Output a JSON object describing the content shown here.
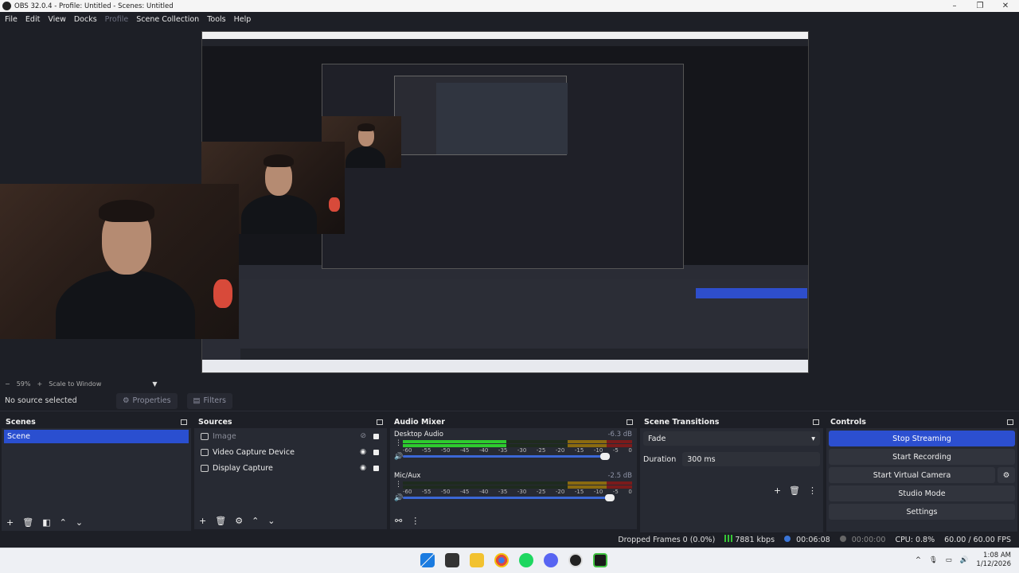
{
  "window": {
    "title": "OBS 32.0.4 - Profile: Untitled - Scenes: Untitled",
    "controls": [
      "–",
      "❐",
      "✕"
    ]
  },
  "menu": [
    {
      "label": "File",
      "enabled": true
    },
    {
      "label": "Edit",
      "enabled": true
    },
    {
      "label": "View",
      "enabled": true
    },
    {
      "label": "Docks",
      "enabled": true
    },
    {
      "label": "Profile",
      "enabled": false
    },
    {
      "label": "Scene Collection",
      "enabled": true
    },
    {
      "label": "Tools",
      "enabled": true
    },
    {
      "label": "Help",
      "enabled": true
    }
  ],
  "zoom": {
    "minus": "−",
    "value": "59%",
    "plus": "+",
    "mode": "Scale to Window",
    "arrow": "▼"
  },
  "source_bar": {
    "status": "No source selected",
    "properties": "Properties",
    "filters": "Filters"
  },
  "scenes": {
    "title": "Scenes",
    "items": [
      "Scene"
    ]
  },
  "sources": {
    "title": "Sources",
    "items": [
      {
        "label": "Image",
        "visible": false
      },
      {
        "label": "Video Capture Device",
        "visible": true
      },
      {
        "label": "Display Capture",
        "visible": true
      }
    ]
  },
  "audio_mixer": {
    "title": "Audio Mixer",
    "ticks": [
      "-60",
      "-55",
      "-50",
      "-45",
      "-40",
      "-35",
      "-30",
      "-25",
      "-20",
      "-15",
      "-10",
      "-5",
      "0"
    ],
    "channels": [
      {
        "name": "Desktop Audio",
        "db": "-6.3 dB",
        "level": 0.45
      },
      {
        "name": "Mic/Aux",
        "db": "-2.5 dB",
        "level": 0.0
      }
    ]
  },
  "transitions": {
    "title": "Scene Transitions",
    "selected": "Fade",
    "duration_label": "Duration",
    "duration_value": "300 ms"
  },
  "controls": {
    "title": "Controls",
    "stop_streaming": "Stop Streaming",
    "start_recording": "Start Recording",
    "start_virtual_camera": "Start Virtual Camera",
    "studio_mode": "Studio Mode",
    "settings": "Settings"
  },
  "status": {
    "dropped_frames": "Dropped Frames 0 (0.0%)",
    "bitrate": "7881 kbps",
    "stream_time": "00:06:08",
    "record_time": "00:00:00",
    "cpu": "CPU: 0.8%",
    "fps": "60.00 / 60.00 FPS"
  },
  "taskbar": {
    "time": "1:08 AM",
    "date": "1/12/2026"
  },
  "colors": {
    "accent": "#2c4fd0",
    "bg": "#1d1f26",
    "dock": "#272a33"
  }
}
